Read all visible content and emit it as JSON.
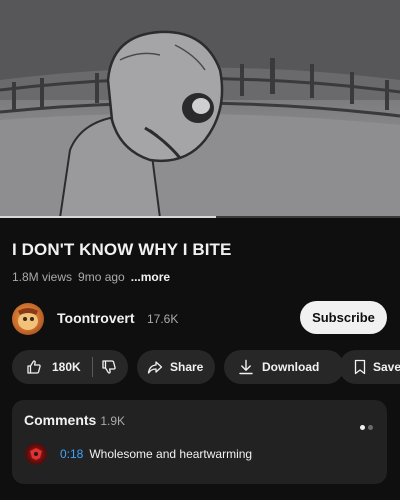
{
  "video": {
    "progress_fraction": 0.54
  },
  "title": "I DON'T KNOW WHY I BITE",
  "meta": {
    "views": "1.8M views",
    "age": "9mo ago",
    "more": "...more"
  },
  "channel": {
    "name": "Toontrovert",
    "subscribers": "17.6K",
    "subscribe_label": "Subscribe"
  },
  "actions": {
    "like_count": "180K",
    "share_label": "Share",
    "download_label": "Download",
    "save_label": "Save"
  },
  "comments": {
    "title": "Comments",
    "count": "1.9K",
    "top_comment": {
      "timestamp": "0:18",
      "text": "Wholesome and heartwarming"
    },
    "pager": {
      "total": 2,
      "active": 0
    }
  },
  "icons": {
    "like": "thumbs-up-icon",
    "dislike": "thumbs-down-icon",
    "share": "share-arrow-icon",
    "download": "download-icon",
    "save": "bookmark-icon"
  },
  "colors": {
    "background": "#0f0f0f",
    "pill": "#272727",
    "card": "#222222",
    "timestamp": "#3ea6ff",
    "subscribe_bg": "#f1f1f1"
  }
}
